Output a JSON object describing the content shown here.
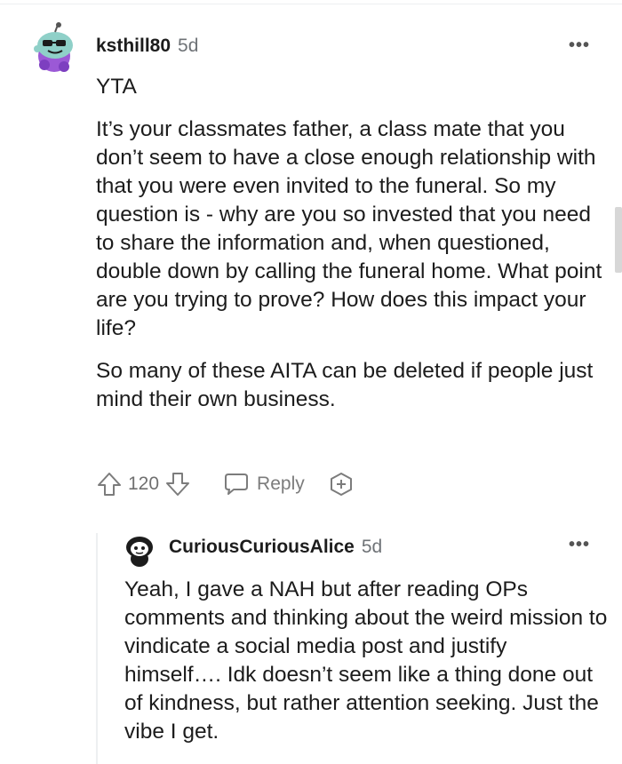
{
  "comment": {
    "username": "ksthill80",
    "age": "5d",
    "avatar_icon": "snoo-avatar-purple-sunglasses",
    "paragraphs": [
      "YTA",
      "It’s your classmates father, a class mate that you don’t seem to have a close enough relationship with that you were even invited to the funeral. So my question is - why are you so invested that you need to share the information and, when questioned, double down by calling the funeral home. What point are you trying to prove? How does this impact your life?",
      "So many of these AITA can be deleted if people just mind their own business."
    ],
    "score": "120",
    "reply_label": "Reply",
    "more_label": "•••"
  },
  "reply": {
    "username": "CuriousCuriousAlice",
    "age": "5d",
    "avatar_icon": "snoo-avatar-black-white",
    "text": "Yeah, I gave a NAH but after reading OPs comments and thinking about the weird mission to vindicate a social media post and justify himself…. Idk doesn’t seem like a thing done out of kindness, but rather attention seeking. Just the vibe I get.",
    "more_label": "•••"
  }
}
